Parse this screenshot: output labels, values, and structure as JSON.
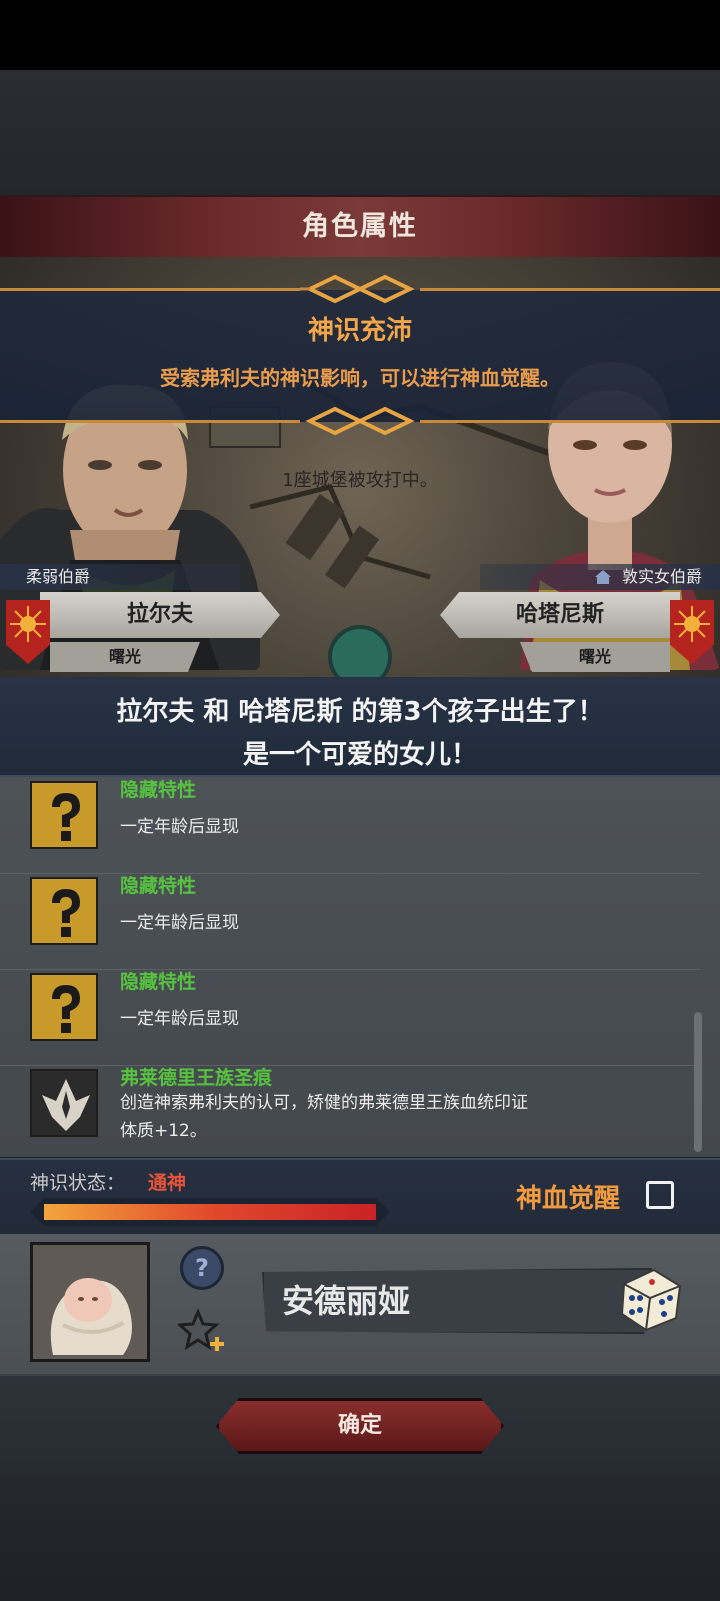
{
  "header": {
    "title": "角色属性"
  },
  "scene": {
    "banner_title": "神识充沛",
    "banner_text": "受索弗利夫的神识影响，可以进行神血觉醒。",
    "siege_text": "1座城堡被攻打中。"
  },
  "father": {
    "title": "柔弱伯爵",
    "name": "拉尔夫",
    "dynasty": "曙光"
  },
  "mother": {
    "title": "敦实女伯爵",
    "name": "哈塔尼斯",
    "dynasty": "曙光"
  },
  "announcement": {
    "line1": "拉尔夫 和 哈塔尼斯 的第3个孩子出生了！",
    "line2": "是一个可爱的女儿！"
  },
  "traits": [
    {
      "name": "隐藏特性",
      "desc": "一定年龄后显现",
      "icon": "question-icon"
    },
    {
      "name": "隐藏特性",
      "desc": "一定年龄后显现",
      "icon": "question-icon"
    },
    {
      "name": "隐藏特性",
      "desc": "一定年龄后显现",
      "icon": "question-icon"
    },
    {
      "name": "弗莱德里王族圣痕",
      "desc": "创造神索弗利夫的认可，矫健的弗莱德里王族血统印证",
      "desc2": "体质+12。",
      "icon": "royal-mark-icon"
    }
  ],
  "status": {
    "label": "神识状态：",
    "value": "通神",
    "progress": 1.0,
    "awaken_label": "神血觉醒",
    "awaken_checked": false
  },
  "child": {
    "name": "安德丽娅",
    "help_label": "?"
  },
  "footer": {
    "confirm_label": "确定"
  },
  "colors": {
    "accent": "#f29a3e",
    "trait_green": "#56c23f",
    "status_red": "#e5533a",
    "title_bar": "#6b2a2c"
  }
}
